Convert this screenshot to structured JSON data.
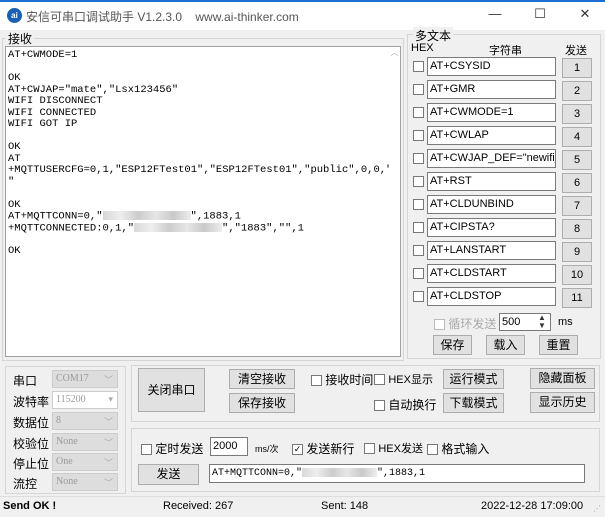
{
  "window": {
    "title": "安信可串口调试助手 V1.2.3.0    www.ai-thinker.com",
    "icon": "ai-logo",
    "minimize": "—",
    "maximize": "☐",
    "close": "✕"
  },
  "receive": {
    "label": "接收",
    "lines": [
      "AT+CWMODE=1",
      "",
      "OK",
      "AT+CWJAP=\"mate\",\"Lsx123456\"",
      "WIFI DISCONNECT",
      "WIFI CONNECTED",
      "WIFI GOT IP",
      "",
      "OK",
      "AT",
      "+MQTTUSERCFG=0,1,\"ESP12FTest01\",\"ESP12FTest01\",\"public\",0,0,\"",
      "\"",
      "",
      "OK"
    ],
    "conn_prefix": "AT+MQTTCONN=0,\"",
    "conn_suffix": "\",1883,1",
    "connected_prefix": "+MQTTCONNECTED:0,1,\"",
    "connected_suffix": "\",\"1883\",\"\",1",
    "last": "OK"
  },
  "multitext": {
    "label": "多文本",
    "hex_header": "HEX",
    "string_header": "字符串",
    "send_header": "发送",
    "rows": [
      {
        "value": "AT+CSYSID",
        "btn": "1"
      },
      {
        "value": "AT+GMR",
        "btn": "2"
      },
      {
        "value": "AT+CWMODE=1",
        "btn": "3"
      },
      {
        "value": "AT+CWLAP",
        "btn": "4"
      },
      {
        "value": "AT+CWJAP_DEF=\"newifi_",
        "btn": "5"
      },
      {
        "value": "AT+RST",
        "btn": "6"
      },
      {
        "value": "AT+CLDUNBIND",
        "btn": "7"
      },
      {
        "value": "AT+CIPSTA?",
        "btn": "8"
      },
      {
        "value": "AT+LANSTART",
        "btn": "9"
      },
      {
        "value": "AT+CLDSTART",
        "btn": "10"
      },
      {
        "value": "AT+CLDSTOP",
        "btn": "11"
      }
    ],
    "loop_label": "循环发送",
    "loop_interval": "500",
    "ms": "ms",
    "save": "保存",
    "load": "载入",
    "reset": "重置"
  },
  "serial": {
    "port_label": "串口",
    "port": "COM17",
    "baud_label": "波特率",
    "baud": "115200",
    "data_label": "数据位",
    "data": "8",
    "parity_label": "校验位",
    "parity": "None",
    "stop_label": "停止位",
    "stop": "One",
    "flow_label": "流控",
    "flow": "None"
  },
  "controls": {
    "close_port": "关闭串口",
    "clear_recv": "清空接收",
    "save_recv": "保存接收",
    "recv_time": "接收时间",
    "hex_display": "HEX显示",
    "auto_wrap": "自动换行",
    "run_mode": "运行模式",
    "download_mode": "下载模式",
    "hide_panel": "隐藏面板",
    "show_history": "显示历史"
  },
  "send": {
    "timed_send": "定时发送",
    "interval": "2000",
    "unit": "ms/次",
    "send_newline": "发送新行",
    "send_newline_checked": true,
    "hex_send": "HEX发送",
    "format_input": "格式输入",
    "send_button": "发送",
    "input_prefix": "AT+MQTTCONN=0,\"",
    "input_suffix": "\",1883,1"
  },
  "status": {
    "message": "Send OK !",
    "received": "Received: 267",
    "sent": "Sent: 148",
    "datetime": "2022-12-28 17:09:00"
  }
}
